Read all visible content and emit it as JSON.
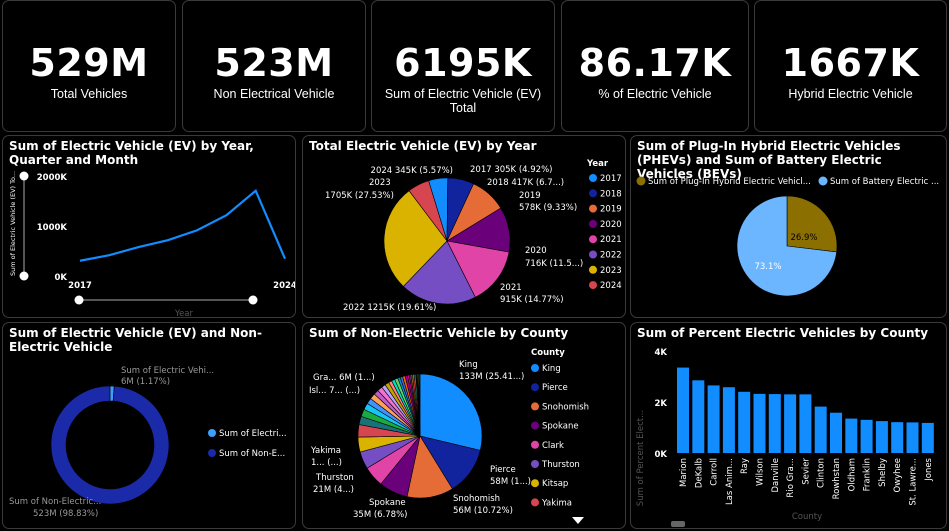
{
  "kpis": [
    {
      "value": "529M",
      "label": "Total Vehicles"
    },
    {
      "value": "523M",
      "label": "Non Electrical Vehicle"
    },
    {
      "value": "6195K",
      "label": "Sum of Electric Vehicle (EV) Total"
    },
    {
      "value": "86.17K",
      "label": "% of Electric Vehicle"
    },
    {
      "value": "1667K",
      "label": "Hybrid Electric Vehicle"
    }
  ],
  "line_chart": {
    "title": "Sum of Electric Vehicle (EV) by Year, Quarter and Month",
    "ylabel": "Sum of Electric Vehicle (EV) To...",
    "xlabel": "Year",
    "yticks": [
      "2000K",
      "1000K",
      "0K"
    ],
    "xticks": [
      "2017",
      "2024"
    ],
    "color": "#118dff"
  },
  "year_pie": {
    "title": "Total Electric Vehicle (EV) by Year",
    "legend_title": "Year",
    "labels": [
      "2017 305K (4.92%)",
      "2018 417K (6.7...)",
      "2019",
      "578K (9.33%)",
      "2020",
      "716K (11.5...)",
      "2021",
      "915K (14.77%)",
      "2022 1215K (19.61%)",
      "2023",
      "1705K (27.53%)",
      "2024 345K (5.57%)"
    ]
  },
  "phev_pie": {
    "title": "Sum of Plug-In Hybrid Electric Vehicles (PHEVs) and Sum of Battery Electric Vehicles (BEVs)",
    "legend": [
      "Sum of Plug-In Hybrid Electric Vehicl...",
      "Sum of Battery Electric ..."
    ],
    "labels": [
      "26.9%",
      "73.1%"
    ]
  },
  "donut": {
    "title": "Sum of Electric Vehicle (EV) and Non-Electric Vehicle",
    "labels": [
      "Sum of Electric Vehi...",
      "6M (1.17%)",
      "Sum of Non-Electric...",
      "523M (98.83%)"
    ],
    "legend": [
      "Sum of Electri...",
      "Sum of Non-E..."
    ]
  },
  "county_pie": {
    "title": "Sum of Non-Electric Vehicle by County",
    "legend_title": "County",
    "labels": [
      "King",
      "133M (25.41...)",
      "Pierce",
      "58M (1...)",
      "Snohomish",
      "56M (10.72%)",
      "Spokane",
      "35M (6.78%)",
      "Thurston",
      "21M (4...)",
      "Yakima",
      "1... (...)",
      "Isl... 7... (...)",
      "Gra... 6M (1...)"
    ]
  },
  "county_bar": {
    "title": "Sum of Percent Electric Vehicles by County",
    "ylabel": "Sum of Percent Elect...",
    "xlabel": "County",
    "yticks": [
      "4K",
      "2K",
      "0K"
    ]
  },
  "chart_data": [
    {
      "type": "line",
      "title": "Sum of Electric Vehicle (EV) by Year, Quarter and Month",
      "xlabel": "Year",
      "ylabel": "Sum of Electric Vehicle (EV) To...",
      "x": [
        2017,
        2018,
        2019,
        2020,
        2021,
        2022,
        2023,
        2024
      ],
      "values": [
        305,
        417,
        578,
        716,
        915,
        1215,
        1705,
        345
      ],
      "ylim": [
        0,
        2000
      ],
      "xlim": [
        2017,
        2024
      ]
    },
    {
      "type": "pie",
      "title": "Total Electric Vehicle (EV) by Year",
      "categories": [
        "2017",
        "2018",
        "2019",
        "2020",
        "2021",
        "2022",
        "2023",
        "2024"
      ],
      "values": [
        305,
        417,
        578,
        716,
        915,
        1215,
        1705,
        345
      ],
      "colors": [
        "#118dff",
        "#12239e",
        "#e66c37",
        "#6b007b",
        "#e044a7",
        "#744ec2",
        "#d9b300",
        "#d64550"
      ]
    },
    {
      "type": "pie",
      "title": "Sum of Plug-In Hybrid Electric Vehicles (PHEVs) and Sum of Battery Electric Vehicles (BEVs)",
      "categories": [
        "Sum of Plug-In Hybrid Electric Vehicl...",
        "Sum of Battery Electric ..."
      ],
      "values": [
        26.9,
        73.1
      ],
      "colors": [
        "#8b6f00",
        "#6bb6ff"
      ]
    },
    {
      "type": "pie",
      "title": "Sum of Electric Vehicle (EV) and Non-Electric Vehicle",
      "categories": [
        "Sum of Electri...",
        "Sum of Non-E..."
      ],
      "values": [
        6,
        523
      ],
      "colors": [
        "#3ba0ff",
        "#1a2aa8"
      ]
    },
    {
      "type": "pie",
      "title": "Sum of Non-Electric Vehicle by County",
      "categories": [
        "King",
        "Pierce",
        "Snohomish",
        "Spokane",
        "Clark",
        "Thurston",
        "Kitsap",
        "Yakima"
      ],
      "values": [
        133,
        58,
        56,
        35,
        25,
        21,
        18,
        15
      ],
      "other_slices": [
        10,
        9,
        8,
        7,
        7,
        6,
        6,
        5,
        5,
        4,
        4,
        4,
        3,
        3,
        3,
        3,
        2,
        2,
        2,
        2,
        2,
        1,
        1,
        1,
        1,
        1
      ],
      "colors": [
        "#118dff",
        "#12239e",
        "#e66c37",
        "#6b007b",
        "#e044a7",
        "#744ec2",
        "#d9b300",
        "#d64550"
      ],
      "other_colors": [
        "#197278",
        "#1aab40",
        "#15c6f4",
        "#4092ff",
        "#ffa058",
        "#be5dc9",
        "#f472d0",
        "#b5a1ff",
        "#c4a200",
        "#ff8080",
        "#00dbbc",
        "#5bd667",
        "#0091d5",
        "#4668c5",
        "#ff6300",
        "#99008a",
        "#ec008c",
        "#533285",
        "#99700a",
        "#ff4141",
        "#1f9a85",
        "#255a26",
        "#009edb",
        "#ffb900",
        "#7fba00",
        "#f25022"
      ]
    },
    {
      "type": "bar",
      "title": "Sum of Percent Electric Vehicles by County",
      "xlabel": "County",
      "ylabel": "Sum of Percent Elect...",
      "categories": [
        "Marion",
        "DeKalb",
        "Carroll",
        "Las Anim...",
        "Ray",
        "Wilson",
        "Danville",
        "Rio Gra...",
        "Sevier",
        "Clinton",
        "Rowhstan",
        "Oldham",
        "Franklin",
        "Shelby",
        "Owyhee",
        "St. Lawre...",
        "Jones"
      ],
      "values": [
        3350,
        2850,
        2650,
        2580,
        2400,
        2320,
        2310,
        2300,
        2300,
        1820,
        1580,
        1350,
        1300,
        1250,
        1210,
        1200,
        1180
      ],
      "ylim": [
        0,
        4000
      ],
      "color": "#118dff"
    }
  ]
}
